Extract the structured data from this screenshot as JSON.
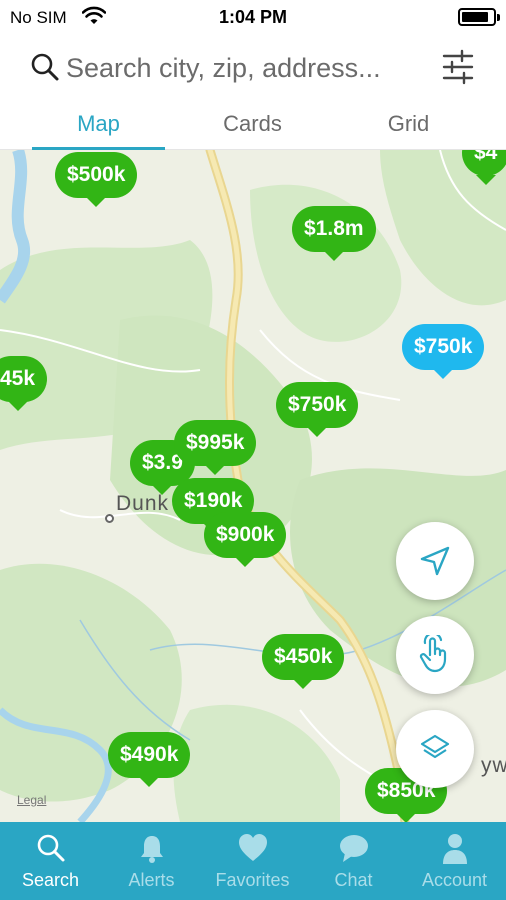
{
  "status": {
    "carrier": "No SIM",
    "time": "1:04 PM"
  },
  "search": {
    "placeholder": "Search city, zip, address..."
  },
  "tabs": [
    {
      "label": "Map",
      "active": true
    },
    {
      "label": "Cards",
      "active": false
    },
    {
      "label": "Grid",
      "active": false
    }
  ],
  "map": {
    "pins": [
      {
        "label": "$500k",
        "color": "green"
      },
      {
        "label": "$4",
        "color": "green"
      },
      {
        "label": "$1.8m",
        "color": "green"
      },
      {
        "label": "$750k",
        "color": "blue"
      },
      {
        "label": "45k",
        "color": "green"
      },
      {
        "label": "$750k",
        "color": "green"
      },
      {
        "label": "$3.9",
        "color": "green"
      },
      {
        "label": "$995k",
        "color": "green"
      },
      {
        "label": "$190k",
        "color": "green"
      },
      {
        "label": "$900k",
        "color": "green"
      },
      {
        "label": "$450k",
        "color": "green"
      },
      {
        "label": "$490k",
        "color": "green"
      },
      {
        "label": "$850k",
        "color": "green"
      }
    ],
    "place_label": "Dunk",
    "place_label_right": "yw",
    "legal": "Legal",
    "controls": {
      "locate": "location-arrow-icon",
      "draw": "hand-pointer-icon",
      "layers": "layers-icon"
    }
  },
  "nav": [
    {
      "label": "Search",
      "icon": "search-icon",
      "active": true
    },
    {
      "label": "Alerts",
      "icon": "bell-icon",
      "active": false
    },
    {
      "label": "Favorites",
      "icon": "heart-icon",
      "active": false
    },
    {
      "label": "Chat",
      "icon": "chat-bubble-icon",
      "active": false
    },
    {
      "label": "Account",
      "icon": "person-icon",
      "active": false
    }
  ],
  "colors": {
    "accent": "#2aa6c4",
    "pin_green": "#32b515",
    "pin_blue": "#1fb8ee"
  }
}
